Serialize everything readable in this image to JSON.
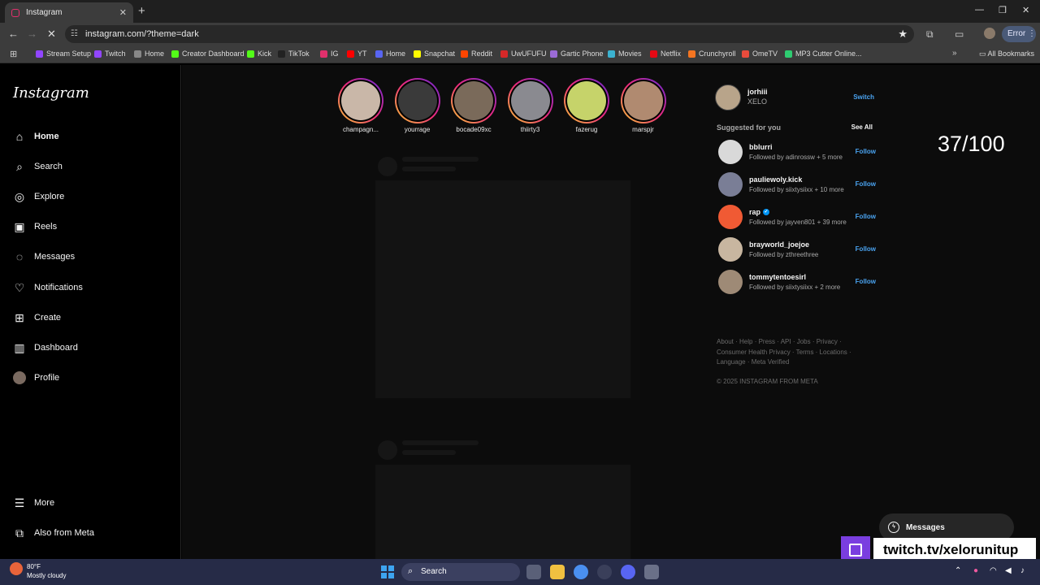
{
  "browser": {
    "tab_title": "Instagram",
    "url": "instagram.com/?theme=dark",
    "profile_status": "Error",
    "bookmarks": [
      {
        "label": "Stream Setup",
        "color": "#9146ff"
      },
      {
        "label": "Twitch",
        "color": "#9146ff"
      },
      {
        "label": "Home",
        "color": "#888888"
      },
      {
        "label": "Creator Dashboard",
        "color": "#53fc18"
      },
      {
        "label": "Kick",
        "color": "#53fc18"
      },
      {
        "label": "TikTok",
        "color": "#222222"
      },
      {
        "label": "IG",
        "color": "#e1306c"
      },
      {
        "label": "YT",
        "color": "#ff0000"
      },
      {
        "label": "Home",
        "color": "#5865f2"
      },
      {
        "label": "Snapchat",
        "color": "#fffc00"
      },
      {
        "label": "Reddit",
        "color": "#ff4500"
      },
      {
        "label": "UwUFUFU",
        "color": "#d62828"
      },
      {
        "label": "Gartic Phone",
        "color": "#9b6bd6"
      },
      {
        "label": "Movies",
        "color": "#3bb2d0"
      },
      {
        "label": "Netflix",
        "color": "#e50914"
      },
      {
        "label": "Crunchyroll",
        "color": "#f47521"
      },
      {
        "label": "OmeTV",
        "color": "#e94b3c"
      },
      {
        "label": "MP3 Cutter Online...",
        "color": "#2ecc71"
      }
    ],
    "all_bookmarks": "All Bookmarks"
  },
  "nav": {
    "logo": "Instagram",
    "items": [
      {
        "label": "Home",
        "icon": "home-icon",
        "glyph": "⌂"
      },
      {
        "label": "Search",
        "icon": "search-icon",
        "glyph": "⌕"
      },
      {
        "label": "Explore",
        "icon": "compass-icon",
        "glyph": "◎"
      },
      {
        "label": "Reels",
        "icon": "reels-icon",
        "glyph": "▣"
      },
      {
        "label": "Messages",
        "icon": "messenger-icon",
        "glyph": "◌"
      },
      {
        "label": "Notifications",
        "icon": "heart-icon",
        "glyph": "♡"
      },
      {
        "label": "Create",
        "icon": "plus-square-icon",
        "glyph": "⊞"
      },
      {
        "label": "Dashboard",
        "icon": "bar-chart-icon",
        "glyph": "▥"
      },
      {
        "label": "Profile",
        "icon": "profile-avatar",
        "glyph": ""
      }
    ],
    "more": "More",
    "also_from_meta": "Also from Meta"
  },
  "stories": [
    {
      "name": "champagn...",
      "color": "#c9b7a8"
    },
    {
      "name": "yourrage",
      "color": "#3a3a3a"
    },
    {
      "name": "bocade09xc",
      "color": "#7a6a5a"
    },
    {
      "name": "thiirty3",
      "color": "#8a8a90"
    },
    {
      "name": "fazerug",
      "color": "#c6d36a"
    },
    {
      "name": "marspjr",
      "color": "#b08a70"
    }
  ],
  "account": {
    "username": "jorhiii",
    "full_name": "XELO",
    "switch": "Switch"
  },
  "suggestions": {
    "header": "Suggested for you",
    "see_all": "See All",
    "follow_label": "Follow",
    "items": [
      {
        "username": "bblurri",
        "sub": "Followed by adinrossw + 5 more",
        "color": "#d9d9d9",
        "verified": false
      },
      {
        "username": "pauliewoly.kick",
        "sub": "Followed by siixtysiixx + 10 more",
        "color": "#7a7e96",
        "verified": false
      },
      {
        "username": "rap",
        "sub": "Followed by jayven801 + 39 more",
        "color": "#f05a34",
        "verified": true
      },
      {
        "username": "brayworld_joejoe",
        "sub": "Followed by zthreethree",
        "color": "#c8b6a0",
        "verified": false
      },
      {
        "username": "tommytentoesirl",
        "sub": "Followed by siixtysiixx + 2 more",
        "color": "#9e8a76",
        "verified": false
      }
    ]
  },
  "footer": {
    "links": "About · Help · Press · API · Jobs · Privacy · Consumer Health Privacy · Terms · Locations · Language · Meta Verified",
    "copyright": "© 2025 INSTAGRAM FROM META"
  },
  "overlay": {
    "counter": "37/100",
    "messages_button": "Messages",
    "twitch_handle": "twitch.tv/xelorunitup"
  },
  "taskbar": {
    "temperature": "80°F",
    "condition": "Mostly cloudy",
    "search": "Search"
  }
}
